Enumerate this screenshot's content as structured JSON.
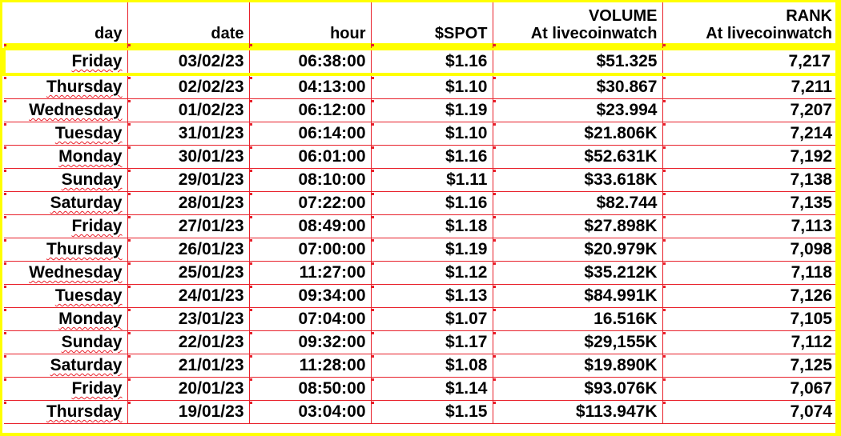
{
  "headers": {
    "day": "day",
    "date": "date",
    "hour": "hour",
    "spot": "$SPOT",
    "volume_line1": "VOLUME",
    "volume_line2": "At livecoinwatch",
    "rank_line1": "RANK",
    "rank_line2": "At livecoinwatch"
  },
  "colors": {
    "gridline": "#e8202a",
    "highlight_border": "#ffff00",
    "page_frame": "#ffff00"
  },
  "rows": [
    {
      "day": "Friday",
      "date": "03/02/23",
      "hour": "06:38:00",
      "spot": "$1.16",
      "volume": "$51.325",
      "rank": "7,217"
    },
    {
      "day": "Thursday",
      "date": "02/02/23",
      "hour": "04:13:00",
      "spot": "$1.10",
      "volume": "$30.867",
      "rank": "7,211"
    },
    {
      "day": "Wednesday",
      "date": "01/02/23",
      "hour": "06:12:00",
      "spot": "$1.19",
      "volume": "$23.994",
      "rank": "7,207"
    },
    {
      "day": "Tuesday",
      "date": "31/01/23",
      "hour": "06:14:00",
      "spot": "$1.10",
      "volume": "$21.806K",
      "rank": "7,214"
    },
    {
      "day": "Monday",
      "date": "30/01/23",
      "hour": "06:01:00",
      "spot": "$1.16",
      "volume": "$52.631K",
      "rank": "7,192"
    },
    {
      "day": "Sunday",
      "date": "29/01/23",
      "hour": "08:10:00",
      "spot": "$1.11",
      "volume": "$33.618K",
      "rank": "7,138"
    },
    {
      "day": "Saturday",
      "date": "28/01/23",
      "hour": "07:22:00",
      "spot": "$1.16",
      "volume": "$82.744",
      "rank": "7,135"
    },
    {
      "day": "Friday",
      "date": "27/01/23",
      "hour": "08:49:00",
      "spot": "$1.18",
      "volume": "$27.898K",
      "rank": "7,113"
    },
    {
      "day": "Thursday",
      "date": "26/01/23",
      "hour": "07:00:00",
      "spot": "$1.19",
      "volume": "$20.979K",
      "rank": "7,098"
    },
    {
      "day": "Wednesday",
      "date": "25/01/23",
      "hour": "11:27:00",
      "spot": "$1.12",
      "volume": "$35.212K",
      "rank": "7,118"
    },
    {
      "day": "Tuesday",
      "date": "24/01/23",
      "hour": "09:34:00",
      "spot": "$1.13",
      "volume": "$84.991K",
      "rank": "7,126"
    },
    {
      "day": "Monday",
      "date": "23/01/23",
      "hour": "07:04:00",
      "spot": "$1.07",
      "volume": "16.516K",
      "rank": "7,105"
    },
    {
      "day": "Sunday",
      "date": "22/01/23",
      "hour": "09:32:00",
      "spot": "$1.17",
      "volume": "$29,155K",
      "rank": "7,112"
    },
    {
      "day": "Saturday",
      "date": "21/01/23",
      "hour": "11:28:00",
      "spot": "$1.08",
      "volume": "$19.890K",
      "rank": "7,125"
    },
    {
      "day": "Friday",
      "date": "20/01/23",
      "hour": "08:50:00",
      "spot": "$1.14",
      "volume": "$93.076K",
      "rank": "7,067"
    },
    {
      "day": "Thursday",
      "date": "19/01/23",
      "hour": "03:04:00",
      "spot": "$1.15",
      "volume": "$113.947K",
      "rank": "7,074"
    }
  ]
}
